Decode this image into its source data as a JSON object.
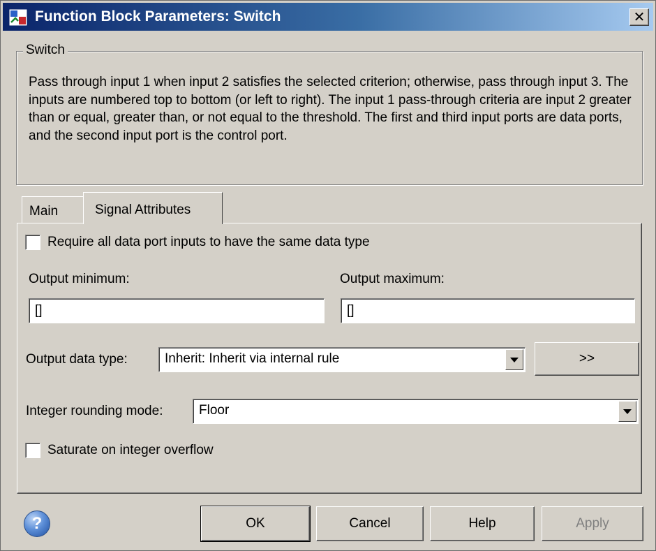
{
  "window": {
    "title": "Function Block Parameters: Switch",
    "close_label": "✕"
  },
  "group": {
    "legend": "Switch",
    "description": "Pass through input 1 when input 2 satisfies the selected criterion; otherwise, pass through input 3.  The inputs are numbered top to bottom (or left to right). The input 1 pass-through criteria are input 2 greater than or equal, greater than, or not equal to the threshold.  The first and third input ports are data ports, and the second input port is the control port."
  },
  "tabs": [
    {
      "label": "Main",
      "active": false
    },
    {
      "label": "Signal Attributes",
      "active": true
    }
  ],
  "signal_attributes": {
    "require_same_type": {
      "label": "Require all data port inputs to have the same data type",
      "checked": false
    },
    "output_minimum": {
      "label": "Output minimum:",
      "value": "[]"
    },
    "output_maximum": {
      "label": "Output maximum:",
      "value": "[]"
    },
    "output_data_type": {
      "label": "Output data type:",
      "value": "Inherit: Inherit via internal rule",
      "assistant_label": ">>"
    },
    "integer_rounding": {
      "label": "Integer rounding mode:",
      "value": "Floor"
    },
    "saturate": {
      "label": "Saturate on integer overflow",
      "checked": false
    }
  },
  "buttons": {
    "ok": "OK",
    "cancel": "Cancel",
    "help": "Help",
    "apply": "Apply",
    "help_icon": "?"
  },
  "colors": {
    "titlebar_start": "#0a246a",
    "titlebar_end": "#a6caf0",
    "dialog_bg": "#d4d0c8"
  }
}
